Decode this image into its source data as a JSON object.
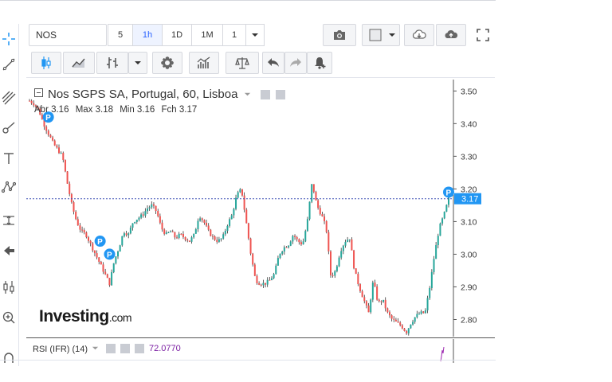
{
  "symbol_input": {
    "value": "NOS"
  },
  "timeframes": [
    {
      "label": "5",
      "active": false
    },
    {
      "label": "1h",
      "active": true
    },
    {
      "label": "1D",
      "active": false
    },
    {
      "label": "1M",
      "active": false
    },
    {
      "label": "1",
      "active": false
    }
  ],
  "legend": {
    "title": "Nos SGPS SA, Portugal, 60, Lisboa",
    "ohlc": {
      "abr": "Abr 3.16",
      "max": "Max 3.18",
      "min": "Min 3.16",
      "fch": "Fch 3.17"
    }
  },
  "brand": {
    "name": "Investing",
    "suffix": ".com"
  },
  "rsi": {
    "label": "RSI (IFR) (14)",
    "value": "72.0770"
  },
  "price_scale": {
    "ticks": [
      "3.50",
      "3.40",
      "3.30",
      "3.20",
      "3.10",
      "3.00",
      "2.90",
      "2.80"
    ],
    "current": "3.17"
  },
  "markers": {
    "label": "P"
  },
  "colors": {
    "up": "#26a69a",
    "down": "#ef5350",
    "accent": "#2196f3",
    "rsi": "#9c27b0"
  },
  "chart_data": {
    "type": "candlestick",
    "title": "Nos SGPS SA, Portugal, 60, Lisboa",
    "y_range": [
      2.75,
      3.53
    ],
    "y_ticks": [
      3.5,
      3.4,
      3.3,
      3.2,
      3.1,
      3.0,
      2.9,
      2.8
    ],
    "last_price": 3.17,
    "last_bar": {
      "open": 3.16,
      "high": 3.18,
      "low": 3.16,
      "close": 3.17
    },
    "approx_close_series": [
      3.47,
      3.46,
      3.44,
      3.4,
      3.37,
      3.34,
      3.32,
      3.3,
      3.22,
      3.15,
      3.1,
      3.07,
      3.06,
      3.03,
      3.0,
      2.97,
      2.94,
      2.91,
      2.98,
      3.02,
      3.07,
      3.06,
      3.1,
      3.11,
      3.12,
      3.14,
      3.15,
      3.13,
      3.08,
      3.06,
      3.07,
      3.05,
      3.06,
      3.05,
      3.04,
      3.06,
      3.12,
      3.1,
      3.07,
      3.05,
      3.04,
      3.05,
      3.09,
      3.12,
      3.18,
      3.2,
      3.1,
      3.0,
      2.92,
      2.91,
      2.91,
      2.92,
      2.94,
      3.0,
      3.02,
      3.03,
      3.06,
      3.04,
      3.03,
      3.1,
      3.22,
      3.15,
      3.12,
      3.08,
      2.93,
      2.95,
      3.01,
      3.04,
      3.05,
      2.95,
      2.9,
      2.86,
      2.82,
      2.92,
      2.85,
      2.86,
      2.82,
      2.8,
      2.79,
      2.78,
      2.76,
      2.79,
      2.81,
      2.82,
      2.82,
      2.9,
      3.0,
      3.08,
      3.12,
      3.17
    ],
    "markers": [
      {
        "label": "P",
        "x_index": 4,
        "y": 3.42
      },
      {
        "label": "P",
        "x_index": 15,
        "y": 3.04
      },
      {
        "label": "P",
        "x_index": 17,
        "y": 3.0
      },
      {
        "label": "P",
        "x_index": 89,
        "y": 3.19
      }
    ],
    "rsi": {
      "name": "RSI (IFR) (14)",
      "last": 72.077
    }
  }
}
